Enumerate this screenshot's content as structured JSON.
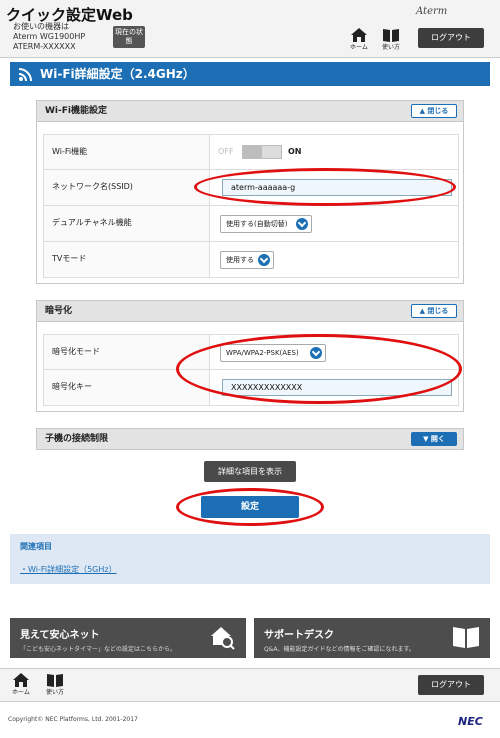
{
  "header": {
    "app_title": "クイック設定Web",
    "device_label": "お使いの機器は",
    "device_model": "Aterm WG1900HP",
    "device_ssid": "ATERM-XXXXXX",
    "status_button": "現在の状態",
    "brand": "Aterm",
    "nav_home": "ホーム",
    "nav_manual": "使い方",
    "logout": "ログアウト"
  },
  "page": {
    "title": "Wi-Fi詳細設定（2.4GHz）"
  },
  "wifi_section": {
    "heading": "Wi-Fi機能設定",
    "collapse_label": "閉じる",
    "rows": {
      "wifi_function": {
        "label": "Wi-Fi機能",
        "off": "OFF",
        "on": "ON"
      },
      "ssid": {
        "label": "ネットワーク名(SSID)",
        "value": "aterm-aaaaaa-g"
      },
      "dual_channel": {
        "label": "デュアルチャネル機能",
        "value": "使用する(自動切替)"
      },
      "tv_mode": {
        "label": "TVモード",
        "value": "使用する"
      }
    }
  },
  "encryption_section": {
    "heading": "暗号化",
    "collapse_label": "閉じる",
    "rows": {
      "mode": {
        "label": "暗号化モード",
        "value": "WPA/WPA2-PSK(AES)"
      },
      "key": {
        "label": "暗号化キー",
        "value": "XXXXXXXXXXXXX"
      }
    }
  },
  "client_section": {
    "heading": "子機の接続制限",
    "expand_label": "開く"
  },
  "buttons": {
    "show_details": "詳細な項目を表示",
    "submit": "設定"
  },
  "related": {
    "title": "関連項目",
    "link": "Wi-Fi詳細設定（5GHz）"
  },
  "promos": {
    "left": {
      "title": "見えて安心ネット",
      "desc": "「こども安心ネットタイマー」などの設定はこちらから。"
    },
    "right": {
      "title": "サポートデスク",
      "desc": "Q&A、機能設定ガイドなどの情報をご確認になれます。"
    }
  },
  "footer": {
    "nav_home": "ホーム",
    "nav_manual": "使い方",
    "logout": "ログアウト",
    "copyright": "Copyright© NEC Platforms, Ltd. 2001-2017",
    "logo": "NEC"
  },
  "colors": {
    "accent": "#1d6fb5",
    "highlight": "#e01010",
    "dark": "#4d4d4d"
  }
}
